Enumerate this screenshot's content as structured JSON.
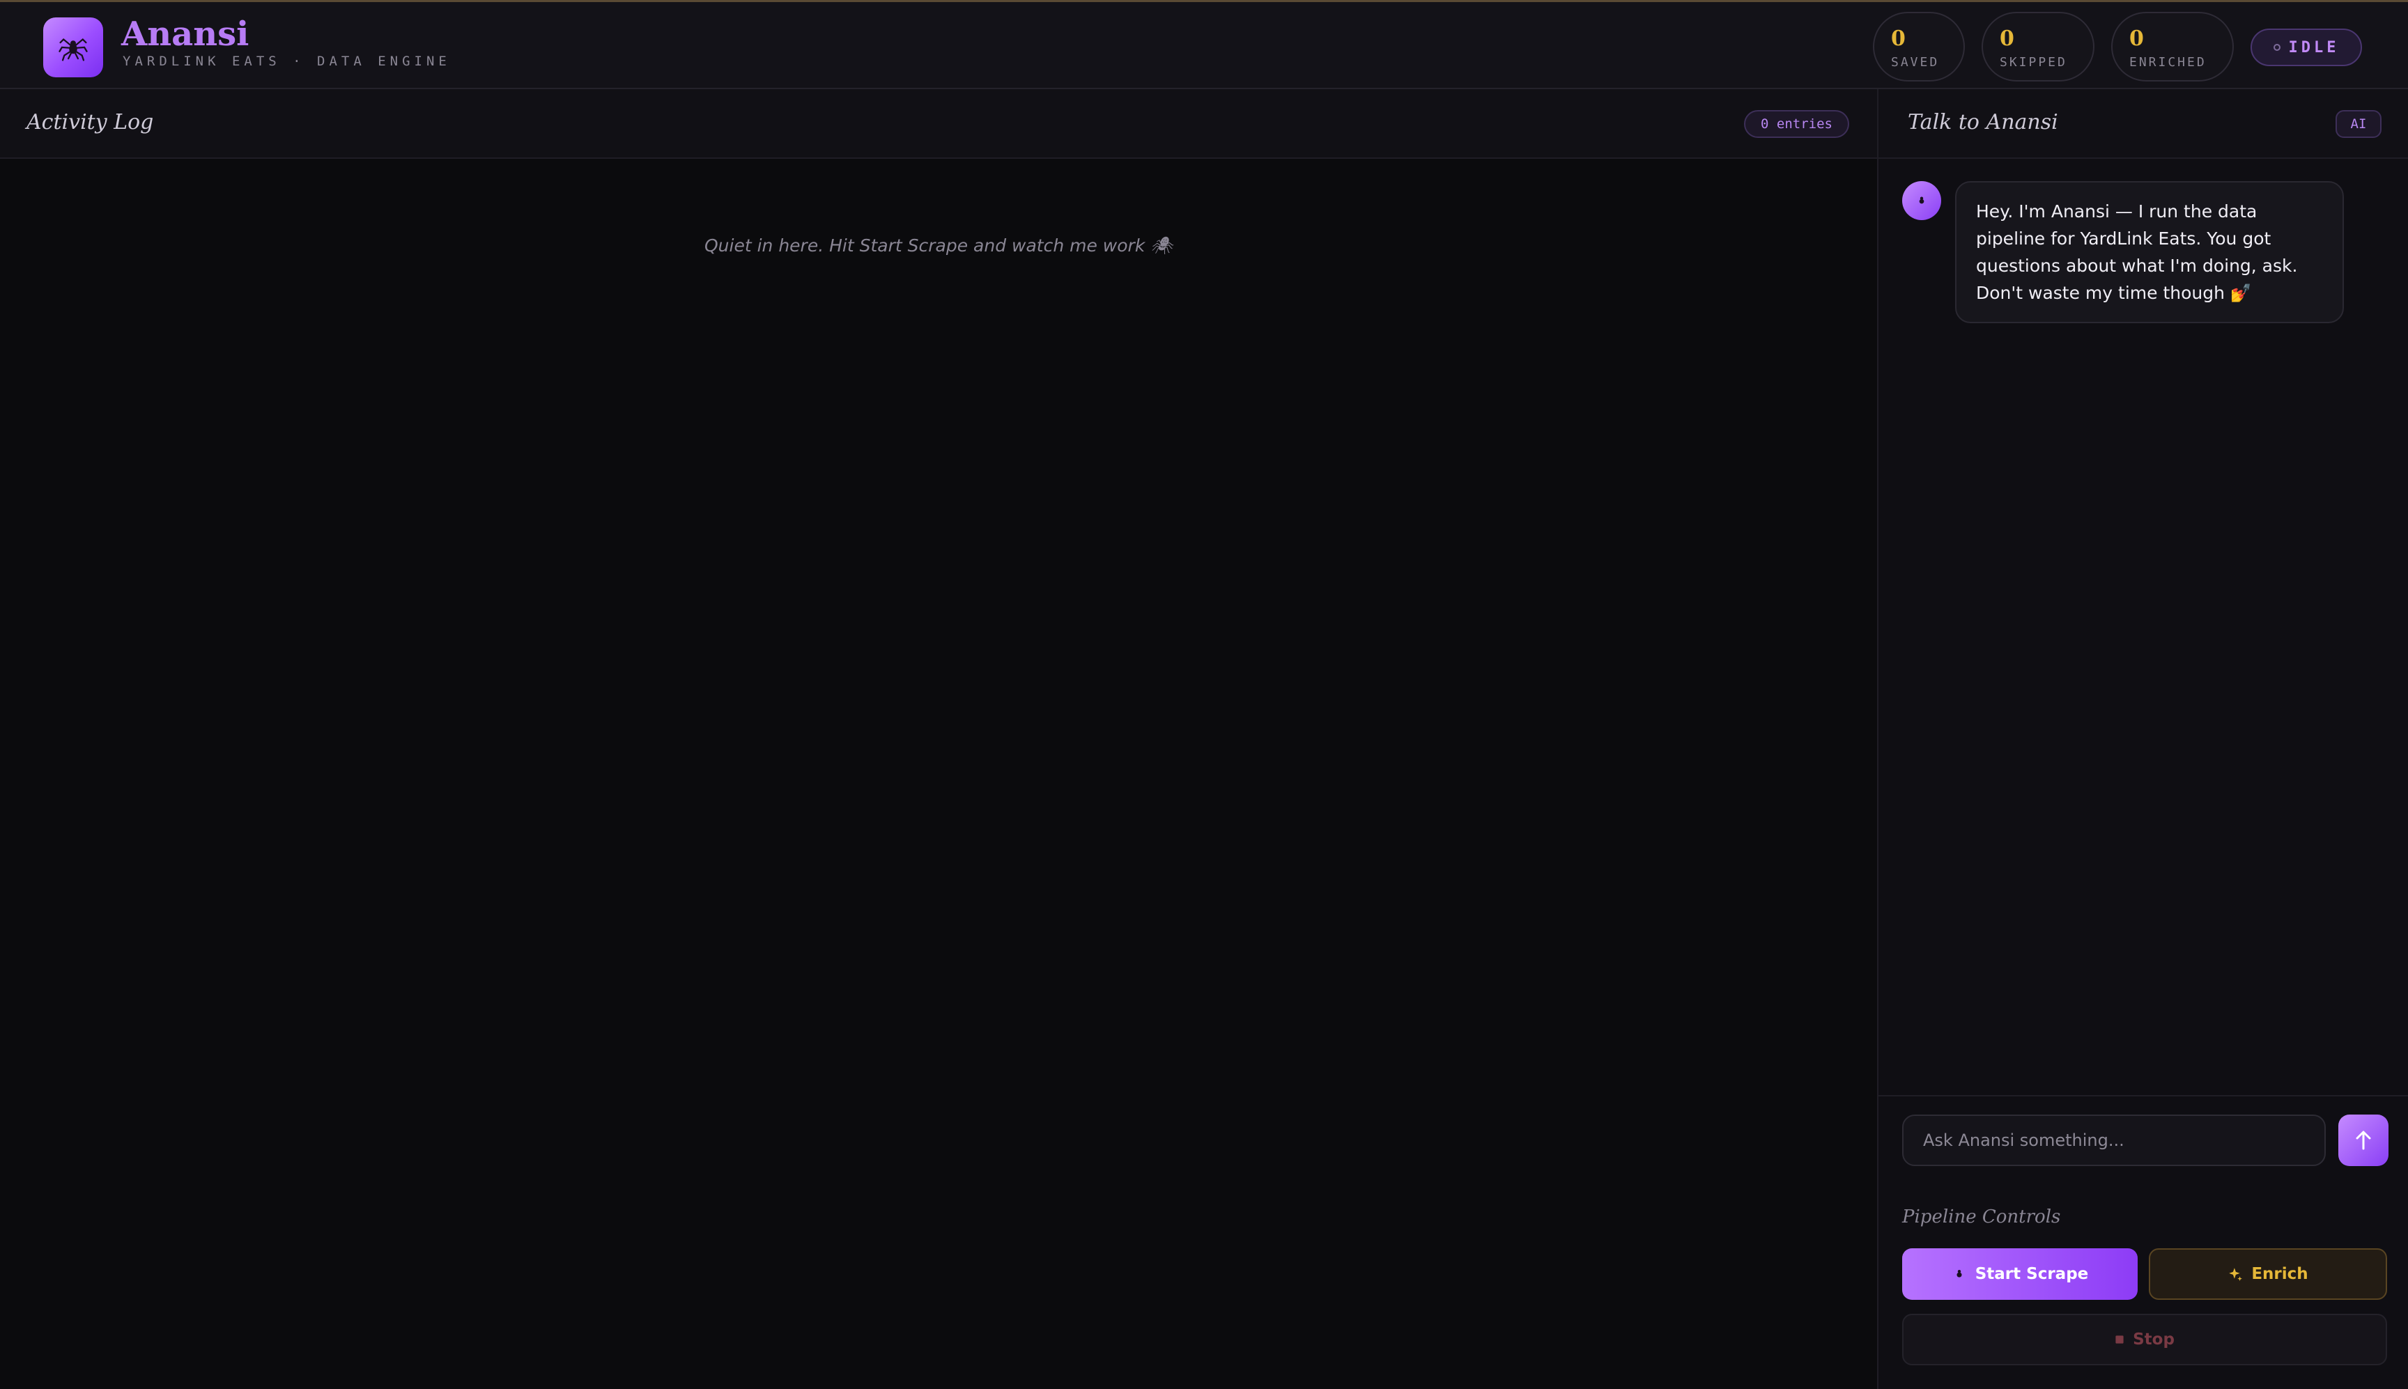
{
  "header": {
    "brand_icon": "spider-icon",
    "brand_name": "Anansi",
    "brand_subtitle": "YARDLINK EATS · DATA ENGINE",
    "stats": [
      {
        "value": "0",
        "label": "SAVED"
      },
      {
        "value": "0",
        "label": "SKIPPED"
      },
      {
        "value": "0",
        "label": "ENRICHED"
      }
    ],
    "status": "IDLE"
  },
  "log": {
    "title": "Activity Log",
    "entries_badge": "0 entries",
    "empty_message": "Quiet in here. Hit Start Scrape and watch me work 🕷"
  },
  "chat": {
    "title": "Talk to Anansi",
    "badge": "AI",
    "messages": [
      {
        "author": "Anansi",
        "text": "Hey. I'm Anansi — I run the data pipeline for YardLink Eats. You got questions about what I'm doing, ask. Don't waste my time though 💅"
      }
    ],
    "input_placeholder": "Ask Anansi something...",
    "send_icon": "arrow-up-icon"
  },
  "controls": {
    "title": "Pipeline Controls",
    "start_label": "Start Scrape",
    "enrich_label": "Enrich",
    "stop_label": "Stop"
  },
  "colors": {
    "accent": "#9b4dff",
    "gold": "#e6b838",
    "background": "#0b0b0d",
    "stop": "#7a3a44"
  }
}
